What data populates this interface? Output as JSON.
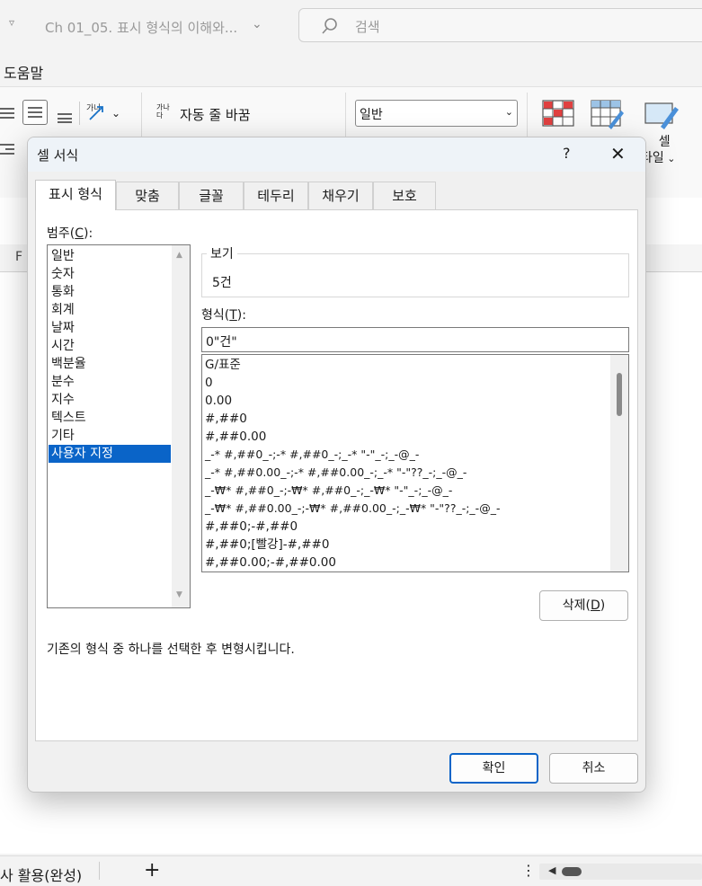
{
  "window": {
    "doc_title": "Ch 01_05. 표시 형식의 이해와...",
    "search_placeholder": "검색",
    "menu_help": "도움말"
  },
  "ribbon": {
    "wrap_text_label": "자동 줄 바꿈",
    "wrap_text_icon_text": "가나다",
    "orientation_icon_text": "가나",
    "number_format_value": "일반",
    "cell_styles_label_line1": "셀",
    "cell_styles_label_line2": "타일"
  },
  "sheet": {
    "column_header": "F",
    "tab_label": "사 활용(완성)",
    "add_sheet": "+"
  },
  "dialog": {
    "title": "셀 서식",
    "help": "?",
    "close": "✕",
    "tabs": [
      {
        "label": "표시 형식"
      },
      {
        "label": "맞춤"
      },
      {
        "label": "글꼴"
      },
      {
        "label": "테두리"
      },
      {
        "label": "채우기"
      },
      {
        "label": "보호"
      }
    ],
    "category_label": "범주(",
    "category_label_key": "C",
    "category_label_end": "):",
    "categories": [
      "일반",
      "숫자",
      "통화",
      "회계",
      "날짜",
      "시간",
      "백분율",
      "분수",
      "지수",
      "텍스트",
      "기타",
      "사용자 지정"
    ],
    "preview_label": "보기",
    "preview_value": "5건",
    "format_label": "형식(",
    "format_label_key": "T",
    "format_label_end": "):",
    "format_input_value": "0\"건\"",
    "format_list": [
      "G/표준",
      "0",
      "0.00",
      "#,##0",
      "#,##0.00",
      "_-* #,##0_-;-* #,##0_-;_-* \"-\"_-;_-@_-",
      "_-* #,##0.00_-;-* #,##0.00_-;_-* \"-\"??_-;_-@_-",
      "_-₩* #,##0_-;-₩* #,##0_-;_-₩* \"-\"_-;_-@_-",
      "_-₩* #,##0.00_-;-₩* #,##0.00_-;_-₩* \"-\"??_-;_-@_-",
      "#,##0;-#,##0",
      "#,##0;[빨강]-#,##0",
      "#,##0.00;-#,##0.00"
    ],
    "delete_label": "삭제(",
    "delete_key": "D",
    "delete_end": ")",
    "description": "기존의 형식 중 하나를 선택한 후 변형시킵니다.",
    "ok_label": "확인",
    "cancel_label": "취소"
  }
}
